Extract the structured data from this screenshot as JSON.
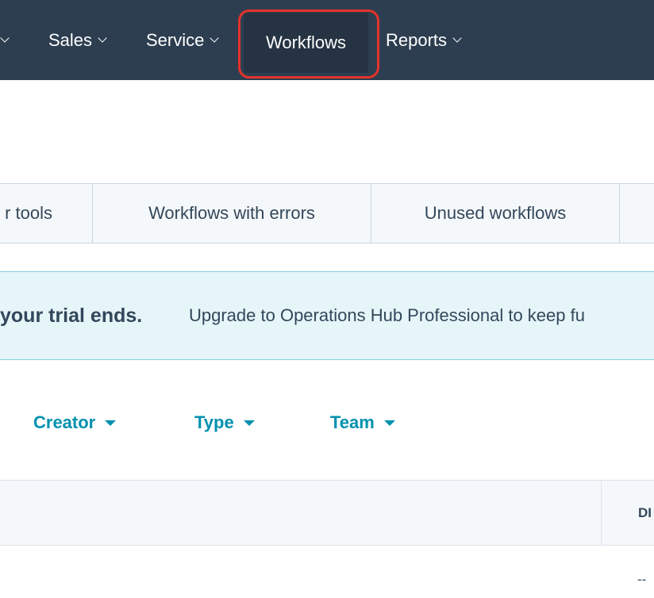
{
  "nav": {
    "items": [
      {
        "label": ""
      },
      {
        "label": "Sales"
      },
      {
        "label": "Service"
      },
      {
        "label": "Workflows"
      },
      {
        "label": "Reports"
      }
    ]
  },
  "tabs": [
    {
      "label": "r tools"
    },
    {
      "label": "Workflows with errors"
    },
    {
      "label": "Unused workflows"
    }
  ],
  "banner": {
    "bold_text": "your trial ends.",
    "text": "Upgrade to Operations Hub Professional to keep fu"
  },
  "filters": [
    {
      "label": "Creator"
    },
    {
      "label": "Type"
    },
    {
      "label": "Team"
    }
  ],
  "table": {
    "header_label": "DI",
    "row_value": "--"
  },
  "colors": {
    "nav_bg": "#2d3e50",
    "highlight": "#e5322a",
    "accent": "#0091ae"
  }
}
